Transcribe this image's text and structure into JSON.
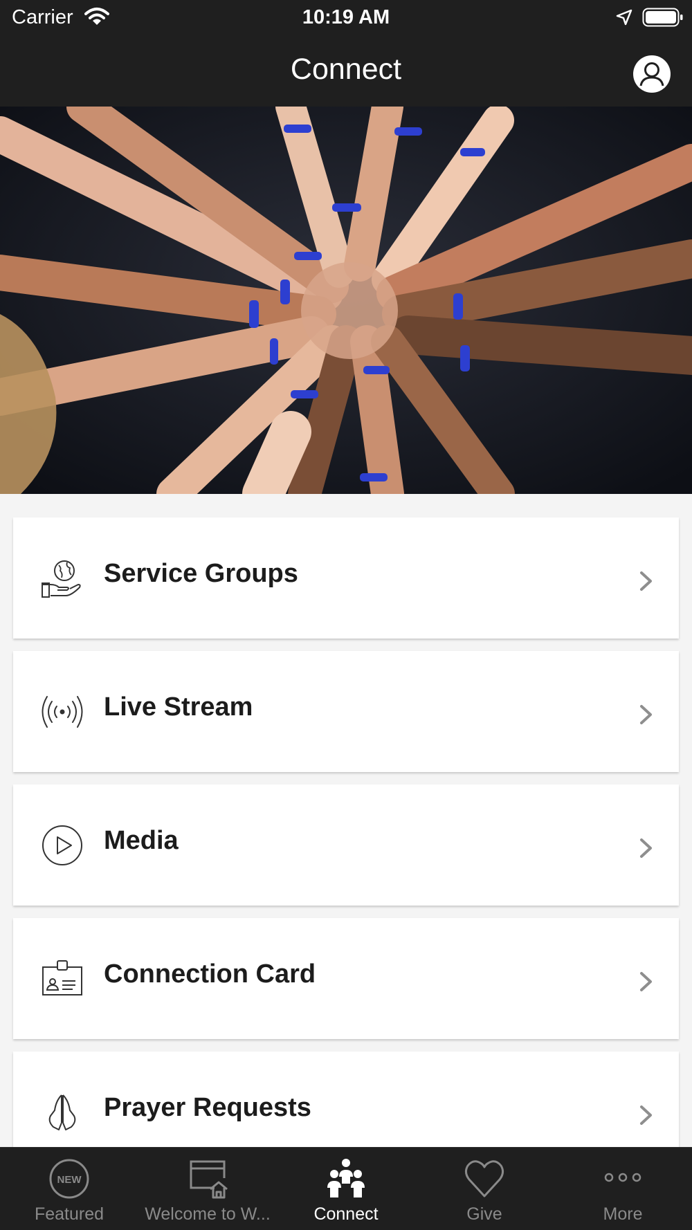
{
  "status_bar": {
    "carrier": "Carrier",
    "time": "10:19 AM"
  },
  "header": {
    "title": "Connect",
    "profile_icon": "person-circle-icon"
  },
  "hero": {
    "image": "stacked-hands-photo"
  },
  "menu": {
    "items": [
      {
        "label": "Service Groups",
        "icon": "globe-in-hand-icon"
      },
      {
        "label": "Live Stream",
        "icon": "broadcast-icon"
      },
      {
        "label": "Media",
        "icon": "play-circle-icon"
      },
      {
        "label": "Connection Card",
        "icon": "id-card-icon"
      },
      {
        "label": "Prayer Requests",
        "icon": "praying-hands-icon"
      }
    ]
  },
  "tab_bar": {
    "tabs": [
      {
        "label": "Featured",
        "icon": "new-badge-icon",
        "active": false
      },
      {
        "label": "Welcome to W...",
        "icon": "browser-home-icon",
        "active": false
      },
      {
        "label": "Connect",
        "icon": "people-group-icon",
        "active": true
      },
      {
        "label": "Give",
        "icon": "heart-icon",
        "active": false
      },
      {
        "label": "More",
        "icon": "more-dots-icon",
        "active": false
      }
    ]
  },
  "colors": {
    "bar_background": "#1f1f1f",
    "page_background": "#f4f4f4",
    "card_background": "#ffffff",
    "active_tab": "#ffffff",
    "inactive_tab": "#8a8a8a"
  }
}
